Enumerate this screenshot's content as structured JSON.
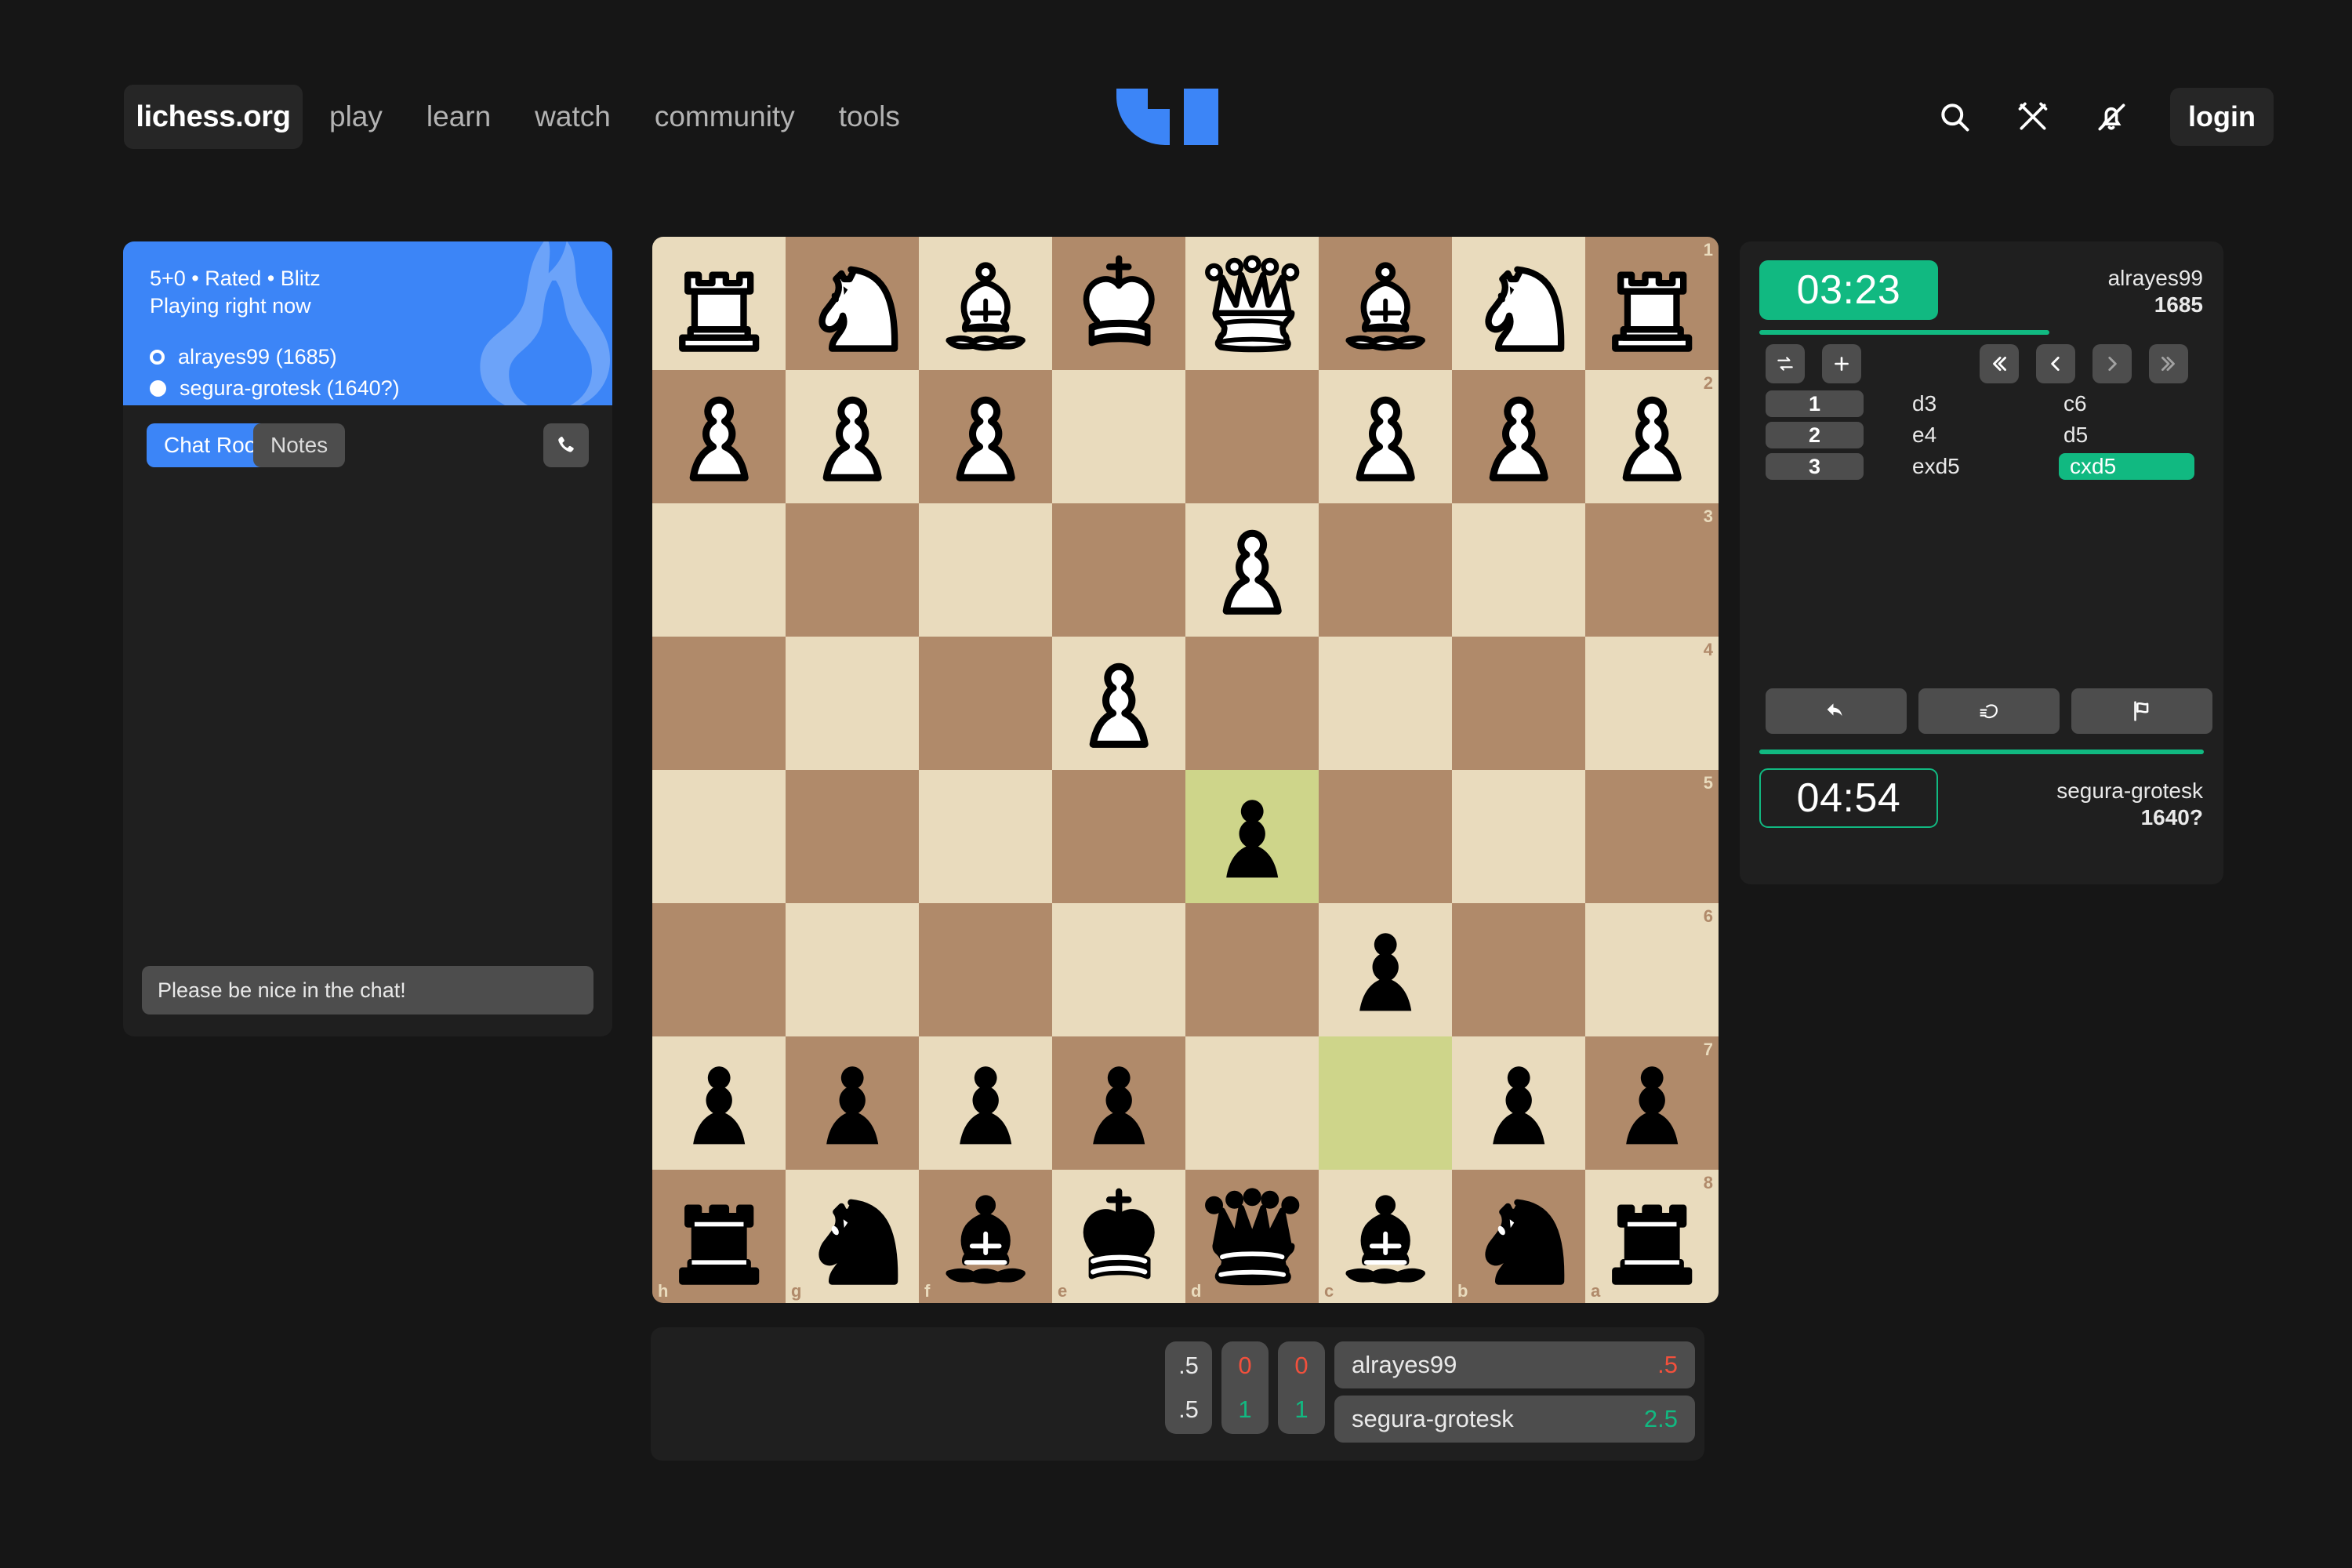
{
  "header": {
    "brand": "lichess.org",
    "nav": [
      {
        "label": "play"
      },
      {
        "label": "learn"
      },
      {
        "label": "watch"
      },
      {
        "label": "community"
      },
      {
        "label": "tools"
      }
    ],
    "icons": [
      "search-icon",
      "crossed-swords-icon",
      "bell-muted-icon"
    ],
    "login_label": "login",
    "logo_color": "#3c85f7"
  },
  "left_panel": {
    "banner": {
      "line1": "5+0 • Rated • Blitz",
      "line2": "Playing right now",
      "white_player": "alrayes99 (1685)",
      "black_player": "segura-grotesk (1640?)",
      "bg_color": "#3c85f7"
    },
    "tabs": {
      "chat_room": "Chat Room",
      "notes": "Notes"
    },
    "call_icon": "phone-icon",
    "chat_input_placeholder": "Please be nice in the chat!",
    "chat_input_value": ""
  },
  "board": {
    "orientation": "black",
    "files": [
      "h",
      "g",
      "f",
      "e",
      "d",
      "c",
      "b",
      "a"
    ],
    "ranks": [
      "1",
      "2",
      "3",
      "4",
      "5",
      "6",
      "7",
      "8"
    ],
    "light_color": "#e9dbbd",
    "dark_color": "#b08a6a",
    "highlight_color": "#ced58a",
    "highlight_squares": [
      "c7",
      "d5"
    ],
    "rows": [
      {
        "rank": "1",
        "cells": [
          {
            "sq": "h1",
            "piece": "wR"
          },
          {
            "sq": "g1",
            "piece": "wN"
          },
          {
            "sq": "f1",
            "piece": "wB"
          },
          {
            "sq": "e1",
            "piece": "wK"
          },
          {
            "sq": "d1",
            "piece": "wQ"
          },
          {
            "sq": "c1",
            "piece": "wB"
          },
          {
            "sq": "b1",
            "piece": "wN"
          },
          {
            "sq": "a1",
            "piece": "wR"
          }
        ]
      },
      {
        "rank": "2",
        "cells": [
          {
            "sq": "h2",
            "piece": "wP"
          },
          {
            "sq": "g2",
            "piece": "wP"
          },
          {
            "sq": "f2",
            "piece": "wP"
          },
          {
            "sq": "e2",
            "piece": null
          },
          {
            "sq": "d2",
            "piece": null
          },
          {
            "sq": "c2",
            "piece": "wP"
          },
          {
            "sq": "b2",
            "piece": "wP"
          },
          {
            "sq": "a2",
            "piece": "wP"
          }
        ]
      },
      {
        "rank": "3",
        "cells": [
          {
            "sq": "h3",
            "piece": null
          },
          {
            "sq": "g3",
            "piece": null
          },
          {
            "sq": "f3",
            "piece": null
          },
          {
            "sq": "e3",
            "piece": null
          },
          {
            "sq": "d3",
            "piece": "wP"
          },
          {
            "sq": "c3",
            "piece": null
          },
          {
            "sq": "b3",
            "piece": null
          },
          {
            "sq": "a3",
            "piece": null
          }
        ]
      },
      {
        "rank": "4",
        "cells": [
          {
            "sq": "h4",
            "piece": null
          },
          {
            "sq": "g4",
            "piece": null
          },
          {
            "sq": "f4",
            "piece": null
          },
          {
            "sq": "e4",
            "piece": "wP"
          },
          {
            "sq": "d4",
            "piece": null
          },
          {
            "sq": "c4",
            "piece": null
          },
          {
            "sq": "b4",
            "piece": null
          },
          {
            "sq": "a4",
            "piece": null
          }
        ]
      },
      {
        "rank": "5",
        "cells": [
          {
            "sq": "h5",
            "piece": null
          },
          {
            "sq": "g5",
            "piece": null
          },
          {
            "sq": "f5",
            "piece": null
          },
          {
            "sq": "e5",
            "piece": null
          },
          {
            "sq": "d5",
            "piece": "bP"
          },
          {
            "sq": "c5",
            "piece": null
          },
          {
            "sq": "b5",
            "piece": null
          },
          {
            "sq": "a5",
            "piece": null
          }
        ]
      },
      {
        "rank": "6",
        "cells": [
          {
            "sq": "h6",
            "piece": null
          },
          {
            "sq": "g6",
            "piece": null
          },
          {
            "sq": "f6",
            "piece": null
          },
          {
            "sq": "e6",
            "piece": null
          },
          {
            "sq": "d6",
            "piece": null
          },
          {
            "sq": "c6",
            "piece": "bP"
          },
          {
            "sq": "b6",
            "piece": null
          },
          {
            "sq": "a6",
            "piece": null
          }
        ]
      },
      {
        "rank": "7",
        "cells": [
          {
            "sq": "h7",
            "piece": "bP"
          },
          {
            "sq": "g7",
            "piece": "bP"
          },
          {
            "sq": "f7",
            "piece": "bP"
          },
          {
            "sq": "e7",
            "piece": "bP"
          },
          {
            "sq": "d7",
            "piece": null
          },
          {
            "sq": "c7",
            "piece": null
          },
          {
            "sq": "b7",
            "piece": "bP"
          },
          {
            "sq": "a7",
            "piece": "bP"
          }
        ]
      },
      {
        "rank": "8",
        "cells": [
          {
            "sq": "h8",
            "piece": "bR"
          },
          {
            "sq": "g8",
            "piece": "bN"
          },
          {
            "sq": "f8",
            "piece": "bB"
          },
          {
            "sq": "e8",
            "piece": "bK"
          },
          {
            "sq": "d8",
            "piece": "bQ"
          },
          {
            "sq": "c8",
            "piece": "bB"
          },
          {
            "sq": "b8",
            "piece": "bN"
          },
          {
            "sq": "a8",
            "piece": "bR"
          }
        ]
      }
    ]
  },
  "right_panel": {
    "clock_top": "03:23",
    "clock_top_active": true,
    "player_top_name": "alrayes99",
    "player_top_rating": "1685",
    "clock_bottom": "04:54",
    "player_bottom_name": "segura-grotesk",
    "player_bottom_rating": "1640?",
    "accent_color": "#11b981",
    "tools": [
      {
        "name": "flip-board-icon"
      },
      {
        "name": "zoom-in-icon"
      }
    ],
    "nav_buttons": [
      {
        "name": "first-move-icon",
        "enabled": true
      },
      {
        "name": "prev-move-icon",
        "enabled": true
      },
      {
        "name": "next-move-icon",
        "enabled": false
      },
      {
        "name": "last-move-icon",
        "enabled": false
      }
    ],
    "moves": [
      {
        "num": "1",
        "white": "d3",
        "black": "c6",
        "active": false
      },
      {
        "num": "2",
        "white": "e4",
        "black": "d5",
        "active": false
      },
      {
        "num": "3",
        "white": "exd5",
        "black": "cxd5",
        "active": true
      }
    ],
    "actions": [
      {
        "name": "takeback-icon"
      },
      {
        "name": "offer-draw-icon"
      },
      {
        "name": "resign-flag-icon"
      }
    ]
  },
  "score_panel": {
    "columns": [
      {
        "top": ".5",
        "top_color": "white",
        "bottom": ".5",
        "bottom_color": "white"
      },
      {
        "top": "0",
        "top_color": "red",
        "bottom": "1",
        "bottom_color": "green"
      },
      {
        "top": "0",
        "top_color": "red",
        "bottom": "1",
        "bottom_color": "green"
      }
    ],
    "rows": [
      {
        "name": "alrayes99",
        "total": ".5",
        "total_color": "red"
      },
      {
        "name": "segura-grotesk",
        "total": "2.5",
        "total_color": "green"
      }
    ]
  }
}
